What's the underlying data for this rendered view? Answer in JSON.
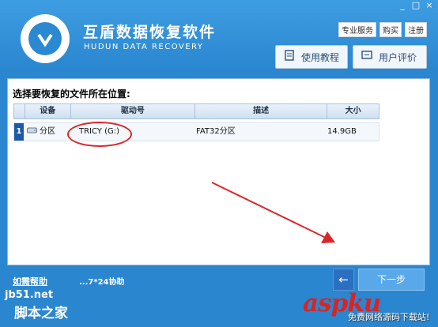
{
  "app": {
    "title": "互盾数据恢复软件",
    "subtitle": "HUDUN DATA RECOVERY"
  },
  "window_controls": [
    "_",
    "□",
    "×"
  ],
  "top_links": [
    "专业服务",
    "购买",
    "注册"
  ],
  "header_buttons": [
    {
      "label": "使用教程",
      "icon": "book-icon"
    },
    {
      "label": "用户评价",
      "icon": "comment-icon"
    }
  ],
  "panel": {
    "title": "选择要恢复的文件所在位置:",
    "columns": [
      "设备",
      "驱动号",
      "描述",
      "大小"
    ],
    "rows": [
      {
        "index": "1",
        "device": "分区",
        "drive": "TRICY (G:)",
        "description": "FAT32分区",
        "size": "14.9GB"
      }
    ]
  },
  "footer": {
    "help_link": "如需帮助",
    "help_text": "...7*24协助",
    "back_label": "←",
    "next_label": "下一步"
  },
  "watermarks": {
    "jb51": "jb51.net",
    "jb51_cn": "脚本之家",
    "aspku": "aspku",
    "aspku_sub": "免费网络源码下载站!"
  },
  "colors": {
    "window_blue": "#2a86cf",
    "annotation_red": "#d8272a"
  }
}
